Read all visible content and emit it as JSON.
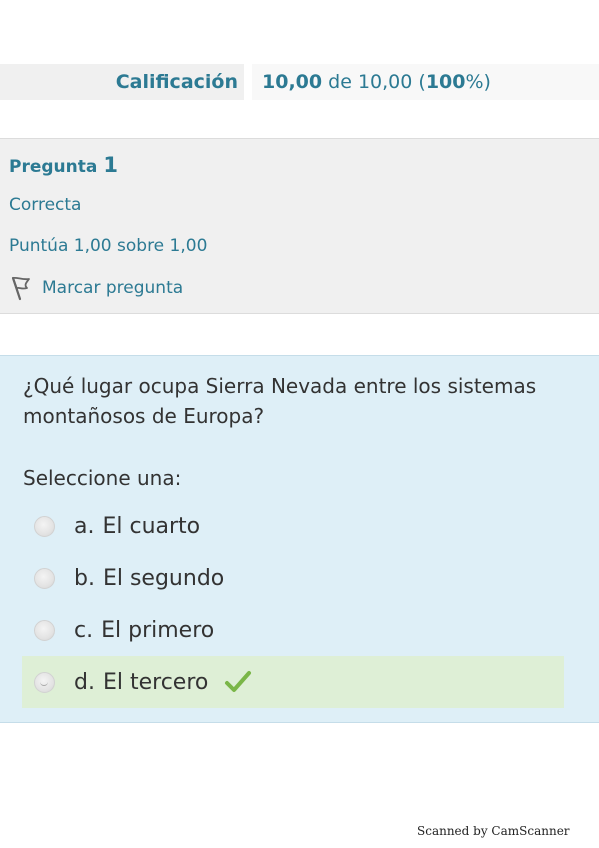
{
  "grade": {
    "label": "Calificación",
    "score": "10,00",
    "of_word": "de",
    "max": "10,00",
    "open_paren": "(",
    "percent": "100",
    "close_paren": "%)"
  },
  "question": {
    "title_word": "Pregunta",
    "number": "1",
    "state": "Correcta",
    "score_text": "Puntúa 1,00 sobre 1,00",
    "flag_label": "Marcar pregunta",
    "flag_icon": "flag-icon"
  },
  "content": {
    "text": "¿Qué lugar ocupa Sierra Nevada entre los sistemas montañosos de Europa?",
    "prompt": "Seleccione una:",
    "answers": [
      {
        "letter": "a.",
        "text": "El cuarto",
        "correct": false
      },
      {
        "letter": "b.",
        "text": "El segundo",
        "correct": false
      },
      {
        "letter": "c.",
        "text": "El primero",
        "correct": false
      },
      {
        "letter": "d.",
        "text": "El tercero",
        "correct": true
      }
    ],
    "check_icon": "check-icon"
  },
  "colors": {
    "accent": "#2c7a93",
    "content_bg": "#deeff7",
    "info_bg": "#f0f0f0",
    "correct_bg": "#deefd6",
    "check": "#7ab648"
  },
  "watermark": "Scanned by CamScanner"
}
